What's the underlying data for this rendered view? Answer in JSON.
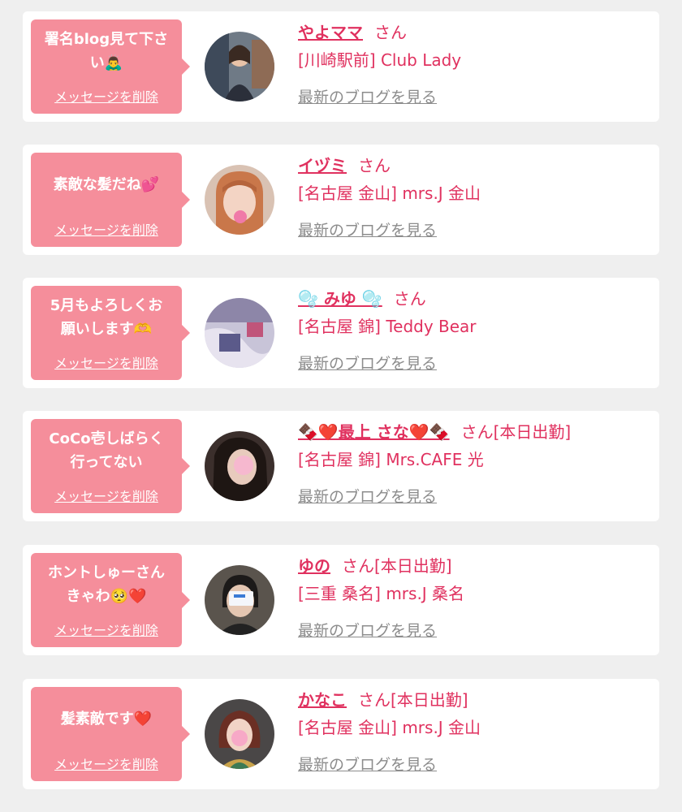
{
  "delete_label": "メッセージを削除",
  "blog_label": "最新のブログを見る",
  "entries": [
    {
      "message_lines": [
        "署名blog見て下さ",
        "い🙇‍♂️"
      ],
      "name": "やよママ",
      "suffix": "さん",
      "shop": "[川崎駅前] Club Lady"
    },
    {
      "message_lines": [
        "素敵な髪だね💕"
      ],
      "name": "イヅミ",
      "suffix": "さん",
      "shop": "[名古屋 金山] mrs.J 金山"
    },
    {
      "message_lines": [
        "5月もよろしくお",
        "願いします🫶"
      ],
      "name": "🫧 みゆ 🫧",
      "suffix": "さん",
      "shop": "[名古屋 錦] Teddy Bear"
    },
    {
      "message_lines": [
        "CoCo壱しばらく",
        "行ってない"
      ],
      "name": "🍫❤️最上 さな❤️🍫",
      "suffix": "さん[本日出勤]",
      "shop": "[名古屋 錦] Mrs.CAFE 光"
    },
    {
      "message_lines": [
        "ホントしゅーさん",
        "きゃわ🥺❤️"
      ],
      "name": "ゆの",
      "suffix": "さん[本日出勤]",
      "shop": "[三重 桑名] mrs.J 桑名"
    },
    {
      "message_lines": [
        "髪素敵です❤️"
      ],
      "name": "かなこ",
      "suffix": "さん[本日出勤]",
      "shop": "[名古屋 金山] mrs.J 金山"
    }
  ]
}
